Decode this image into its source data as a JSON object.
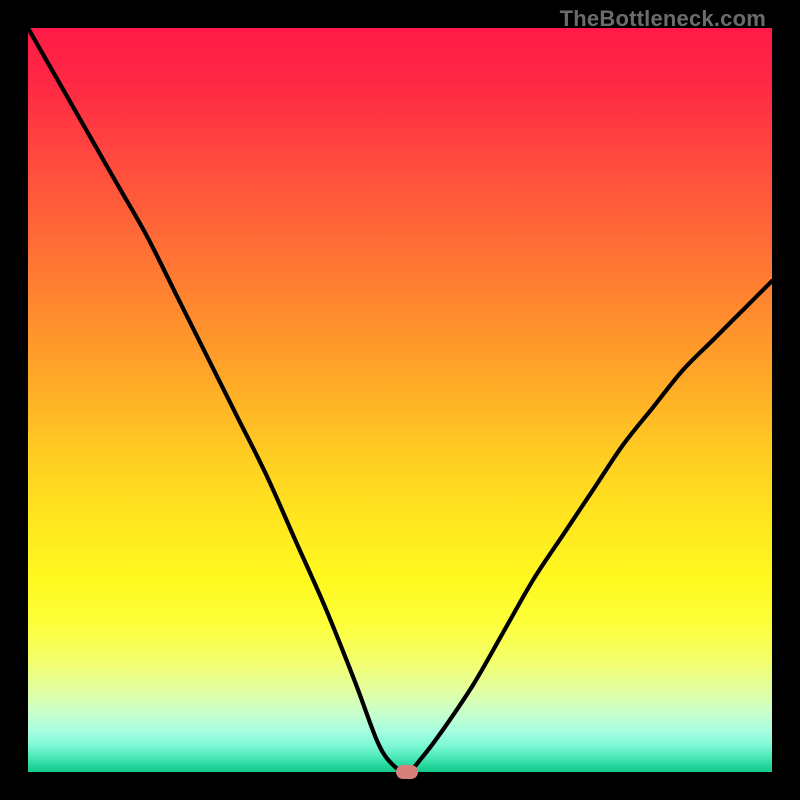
{
  "watermark": "TheBottleneck.com",
  "chart_data": {
    "type": "line",
    "title": "",
    "xlabel": "",
    "ylabel": "",
    "xlim": [
      0,
      100
    ],
    "ylim": [
      0,
      100
    ],
    "grid": false,
    "legend": false,
    "series": [
      {
        "name": "bottleneck-curve",
        "x": [
          0,
          4,
          8,
          12,
          16,
          20,
          24,
          28,
          32,
          36,
          40,
          44,
          47,
          49,
          51,
          53,
          56,
          60,
          64,
          68,
          72,
          76,
          80,
          84,
          88,
          92,
          96,
          100
        ],
        "y": [
          100,
          93,
          86,
          79,
          72,
          64,
          56,
          48,
          40,
          31,
          22,
          12,
          4,
          1,
          0,
          2,
          6,
          12,
          19,
          26,
          32,
          38,
          44,
          49,
          54,
          58,
          62,
          66
        ]
      }
    ],
    "optimum_marker": {
      "x": 51,
      "y": 0
    },
    "colors": {
      "gradient_top": "#ff1a47",
      "gradient_bottom": "#14c888",
      "curve": "#000000",
      "marker": "#d77f7a",
      "frame": "#000000",
      "watermark": "#6b6b6b"
    }
  }
}
